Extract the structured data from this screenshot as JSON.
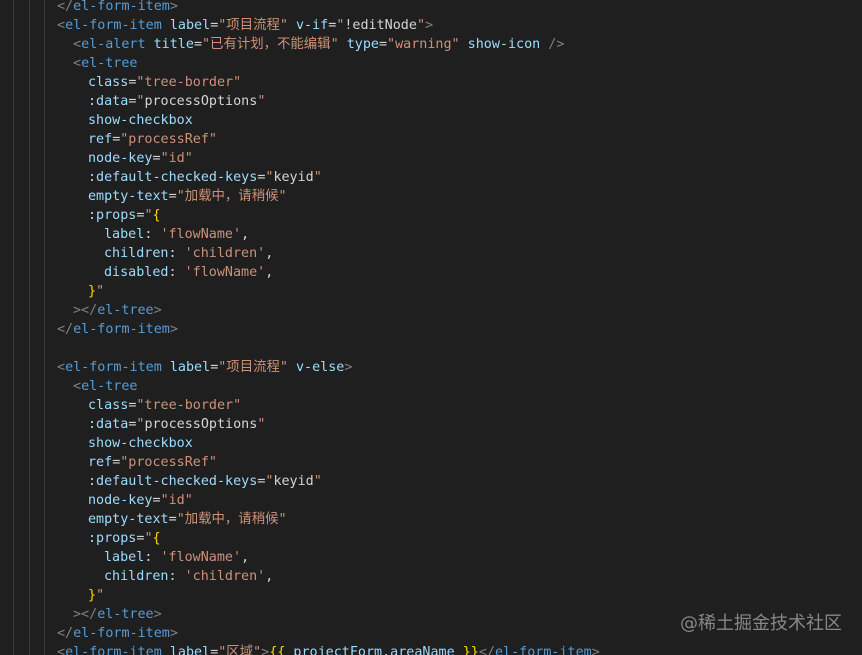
{
  "watermark": "@稀土掘金技术社区",
  "colors": {
    "background": "#1f1f1f",
    "tag": "#569cd6",
    "bracket": "#808080",
    "attribute": "#9cdcfe",
    "string": "#ce9178",
    "text": "#d4d4d4",
    "mustache": "#ffd700"
  },
  "lines": [
    [
      {
        "c": "t-br",
        "v": "</"
      },
      {
        "c": "t-tag",
        "v": "el-form-item"
      },
      {
        "c": "t-br",
        "v": ">"
      }
    ],
    [
      {
        "c": "t-br",
        "v": "<"
      },
      {
        "c": "t-tag",
        "v": "el-form-item"
      },
      {
        "c": "t-txt",
        "v": " "
      },
      {
        "c": "t-attr",
        "v": "label"
      },
      {
        "c": "t-eq",
        "v": "="
      },
      {
        "c": "t-str",
        "v": "\"项目流程\""
      },
      {
        "c": "t-txt",
        "v": " "
      },
      {
        "c": "t-attr",
        "v": "v-if"
      },
      {
        "c": "t-eq",
        "v": "="
      },
      {
        "c": "t-str",
        "v": "\""
      },
      {
        "c": "t-txt",
        "v": "!editNode"
      },
      {
        "c": "t-str",
        "v": "\""
      },
      {
        "c": "t-br",
        "v": ">"
      }
    ],
    [
      {
        "c": "t-br",
        "v": "<"
      },
      {
        "c": "t-tag",
        "v": "el-alert"
      },
      {
        "c": "t-txt",
        "v": " "
      },
      {
        "c": "t-attr",
        "v": "title"
      },
      {
        "c": "t-eq",
        "v": "="
      },
      {
        "c": "t-str",
        "v": "\"已有计划，不能编辑\""
      },
      {
        "c": "t-txt",
        "v": " "
      },
      {
        "c": "t-attr",
        "v": "type"
      },
      {
        "c": "t-eq",
        "v": "="
      },
      {
        "c": "t-str",
        "v": "\"warning\""
      },
      {
        "c": "t-txt",
        "v": " "
      },
      {
        "c": "t-attr",
        "v": "show-icon"
      },
      {
        "c": "t-txt",
        "v": " "
      },
      {
        "c": "t-br",
        "v": "/>"
      }
    ],
    [
      {
        "c": "t-br",
        "v": "<"
      },
      {
        "c": "t-tag",
        "v": "el-tree"
      }
    ],
    [
      {
        "c": "t-attr",
        "v": "class"
      },
      {
        "c": "t-eq",
        "v": "="
      },
      {
        "c": "t-str",
        "v": "\"tree-border\""
      }
    ],
    [
      {
        "c": "t-attr",
        "v": ":data"
      },
      {
        "c": "t-eq",
        "v": "="
      },
      {
        "c": "t-str",
        "v": "\""
      },
      {
        "c": "t-txt",
        "v": "processOptions"
      },
      {
        "c": "t-str",
        "v": "\""
      }
    ],
    [
      {
        "c": "t-attr",
        "v": "show-checkbox"
      }
    ],
    [
      {
        "c": "t-attr",
        "v": "ref"
      },
      {
        "c": "t-eq",
        "v": "="
      },
      {
        "c": "t-str",
        "v": "\"processRef\""
      }
    ],
    [
      {
        "c": "t-attr",
        "v": "node-key"
      },
      {
        "c": "t-eq",
        "v": "="
      },
      {
        "c": "t-str",
        "v": "\"id\""
      }
    ],
    [
      {
        "c": "t-attr",
        "v": ":default-checked-keys"
      },
      {
        "c": "t-eq",
        "v": "="
      },
      {
        "c": "t-str",
        "v": "\""
      },
      {
        "c": "t-txt",
        "v": "keyid"
      },
      {
        "c": "t-str",
        "v": "\""
      }
    ],
    [
      {
        "c": "t-attr",
        "v": "empty-text"
      },
      {
        "c": "t-eq",
        "v": "="
      },
      {
        "c": "t-str",
        "v": "\"加载中，请稍候\""
      }
    ],
    [
      {
        "c": "t-attr",
        "v": ":props"
      },
      {
        "c": "t-eq",
        "v": "="
      },
      {
        "c": "t-str",
        "v": "\""
      },
      {
        "c": "t-mus",
        "v": "{"
      }
    ],
    [
      {
        "c": "t-key",
        "v": "label"
      },
      {
        "c": "t-punc",
        "v": ": "
      },
      {
        "c": "t-str",
        "v": "'flowName'"
      },
      {
        "c": "t-punc",
        "v": ","
      }
    ],
    [
      {
        "c": "t-key",
        "v": "children"
      },
      {
        "c": "t-punc",
        "v": ": "
      },
      {
        "c": "t-str",
        "v": "'children'"
      },
      {
        "c": "t-punc",
        "v": ","
      }
    ],
    [
      {
        "c": "t-key",
        "v": "disabled"
      },
      {
        "c": "t-punc",
        "v": ": "
      },
      {
        "c": "t-str",
        "v": "'flowName'"
      },
      {
        "c": "t-punc",
        "v": ","
      }
    ],
    [
      {
        "c": "t-mus",
        "v": "}"
      },
      {
        "c": "t-str",
        "v": "\""
      }
    ],
    [
      {
        "c": "t-br",
        "v": "></"
      },
      {
        "c": "t-tag",
        "v": "el-tree"
      },
      {
        "c": "t-br",
        "v": ">"
      }
    ],
    [
      {
        "c": "t-br",
        "v": "</"
      },
      {
        "c": "t-tag",
        "v": "el-form-item"
      },
      {
        "c": "t-br",
        "v": ">"
      }
    ],
    [],
    [
      {
        "c": "t-br",
        "v": "<"
      },
      {
        "c": "t-tag",
        "v": "el-form-item"
      },
      {
        "c": "t-txt",
        "v": " "
      },
      {
        "c": "t-attr",
        "v": "label"
      },
      {
        "c": "t-eq",
        "v": "="
      },
      {
        "c": "t-str",
        "v": "\"项目流程\""
      },
      {
        "c": "t-txt",
        "v": " "
      },
      {
        "c": "t-attr",
        "v": "v-else"
      },
      {
        "c": "t-br",
        "v": ">"
      }
    ],
    [
      {
        "c": "t-br",
        "v": "<"
      },
      {
        "c": "t-tag",
        "v": "el-tree"
      }
    ],
    [
      {
        "c": "t-attr",
        "v": "class"
      },
      {
        "c": "t-eq",
        "v": "="
      },
      {
        "c": "t-str",
        "v": "\"tree-border\""
      }
    ],
    [
      {
        "c": "t-attr",
        "v": ":data"
      },
      {
        "c": "t-eq",
        "v": "="
      },
      {
        "c": "t-str",
        "v": "\""
      },
      {
        "c": "t-txt",
        "v": "processOptions"
      },
      {
        "c": "t-str",
        "v": "\""
      }
    ],
    [
      {
        "c": "t-attr",
        "v": "show-checkbox"
      }
    ],
    [
      {
        "c": "t-attr",
        "v": "ref"
      },
      {
        "c": "t-eq",
        "v": "="
      },
      {
        "c": "t-str",
        "v": "\"processRef\""
      }
    ],
    [
      {
        "c": "t-attr",
        "v": ":default-checked-keys"
      },
      {
        "c": "t-eq",
        "v": "="
      },
      {
        "c": "t-str",
        "v": "\""
      },
      {
        "c": "t-txt",
        "v": "keyid"
      },
      {
        "c": "t-str",
        "v": "\""
      }
    ],
    [
      {
        "c": "t-attr",
        "v": "node-key"
      },
      {
        "c": "t-eq",
        "v": "="
      },
      {
        "c": "t-str",
        "v": "\"id\""
      }
    ],
    [
      {
        "c": "t-attr",
        "v": "empty-text"
      },
      {
        "c": "t-eq",
        "v": "="
      },
      {
        "c": "t-str",
        "v": "\"加载中，请稍候\""
      }
    ],
    [
      {
        "c": "t-attr",
        "v": ":props"
      },
      {
        "c": "t-eq",
        "v": "="
      },
      {
        "c": "t-str",
        "v": "\""
      },
      {
        "c": "t-mus",
        "v": "{"
      }
    ],
    [
      {
        "c": "t-key",
        "v": "label"
      },
      {
        "c": "t-punc",
        "v": ": "
      },
      {
        "c": "t-str",
        "v": "'flowName'"
      },
      {
        "c": "t-punc",
        "v": ","
      }
    ],
    [
      {
        "c": "t-key",
        "v": "children"
      },
      {
        "c": "t-punc",
        "v": ": "
      },
      {
        "c": "t-str",
        "v": "'children'"
      },
      {
        "c": "t-punc",
        "v": ","
      }
    ],
    [
      {
        "c": "t-mus",
        "v": "}"
      },
      {
        "c": "t-str",
        "v": "\""
      }
    ],
    [
      {
        "c": "t-br",
        "v": "></"
      },
      {
        "c": "t-tag",
        "v": "el-tree"
      },
      {
        "c": "t-br",
        "v": ">"
      }
    ],
    [
      {
        "c": "t-br",
        "v": "</"
      },
      {
        "c": "t-tag",
        "v": "el-form-item"
      },
      {
        "c": "t-br",
        "v": ">"
      }
    ],
    [
      {
        "c": "t-br",
        "v": "<"
      },
      {
        "c": "t-tag",
        "v": "el-form-item"
      },
      {
        "c": "t-txt",
        "v": " "
      },
      {
        "c": "t-attr",
        "v": "label"
      },
      {
        "c": "t-eq",
        "v": "="
      },
      {
        "c": "t-str",
        "v": "\"区域\""
      },
      {
        "c": "t-br",
        "v": ">"
      },
      {
        "c": "t-mus",
        "v": "{{ "
      },
      {
        "c": "t-attr",
        "v": "projectForm"
      },
      {
        "c": "t-txt",
        "v": "."
      },
      {
        "c": "t-attr",
        "v": "areaName"
      },
      {
        "c": "t-mus",
        "v": " }}"
      },
      {
        "c": "t-br",
        "v": "</"
      },
      {
        "c": "t-tag",
        "v": "el-form-item"
      },
      {
        "c": "t-br",
        "v": ">"
      }
    ]
  ]
}
